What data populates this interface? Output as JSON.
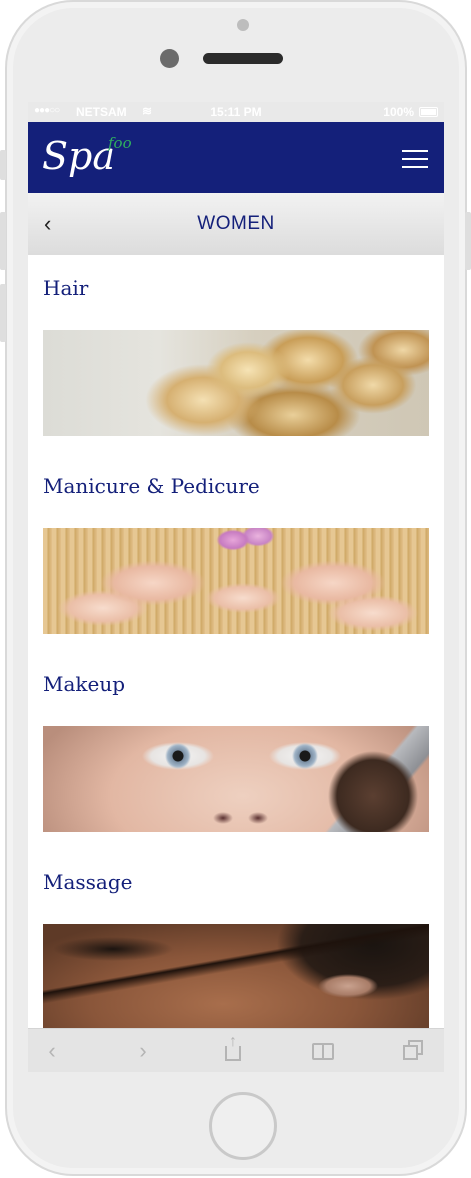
{
  "status_bar": {
    "signal": "●●●○○",
    "carrier": "NETSAM",
    "wifi_icon": "wifi-icon",
    "time": "15:11 PM",
    "battery": "100%"
  },
  "nav": {
    "logo_main": "Spa",
    "logo_accent": "foo",
    "logo_accent_color": "#2fae5f",
    "bar_color": "#14207a",
    "menu_icon": "hamburger-menu-icon"
  },
  "title_bar": {
    "back_icon": "chevron-left-icon",
    "back_glyph": "‹",
    "title": "WOMEN"
  },
  "categories": [
    {
      "title": "Hair",
      "image": "blonde curled hair updo"
    },
    {
      "title": "Manicure & Pedicure",
      "image": "manicured hands and feet"
    },
    {
      "title": "Makeup",
      "image": "eyes with makeup brush"
    },
    {
      "title": "Massage",
      "image": "face massage"
    }
  ],
  "toolbar": {
    "back_glyph": "‹",
    "forward_glyph": "›",
    "share_glyph": "↑",
    "icons": [
      "back-arrow-icon",
      "forward-arrow-icon",
      "share-icon",
      "bookmarks-icon",
      "tabs-icon"
    ]
  }
}
